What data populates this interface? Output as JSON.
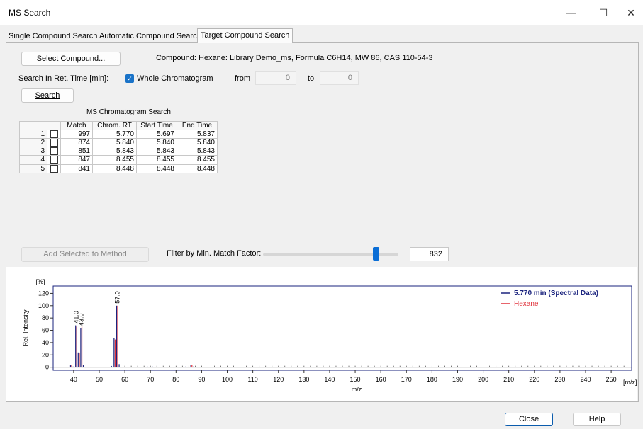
{
  "window": {
    "title": "MS Search",
    "minimize": "—",
    "maximize": "☐",
    "close": "✕"
  },
  "tabs": [
    {
      "label": "Single Compound Search",
      "active": false
    },
    {
      "label": "Automatic Compound Search",
      "active": false
    },
    {
      "label": "Target Compound Search",
      "active": true
    }
  ],
  "target": {
    "select_button": "Select Compound...",
    "compound_label": "Compound:",
    "compound_value": "Hexane: Library Demo_ms, Formula C6H14, MW 86, CAS 110-54-3",
    "search_in_label": "Search In Ret. Time [min]:",
    "whole_chrom_label": "Whole Chromatogram",
    "whole_chrom_checked": true,
    "from_label": "from",
    "from_value": "0",
    "to_label": "to",
    "to_value": "0",
    "search_button": "Search",
    "table_title": "MS Chromatogram Search",
    "columns": [
      "",
      "",
      "Match",
      "Chrom. RT",
      "Start Time",
      "End Time"
    ],
    "rows": [
      {
        "n": "1",
        "match": "997",
        "rt": "5.770",
        "start": "5.697",
        "end": "5.837"
      },
      {
        "n": "2",
        "match": "874",
        "rt": "5.840",
        "start": "5.840",
        "end": "5.840"
      },
      {
        "n": "3",
        "match": "851",
        "rt": "5.843",
        "start": "5.843",
        "end": "5.843"
      },
      {
        "n": "4",
        "match": "847",
        "rt": "8.455",
        "start": "8.455",
        "end": "8.455"
      },
      {
        "n": "5",
        "match": "841",
        "rt": "8.448",
        "start": "8.448",
        "end": "8.448"
      }
    ],
    "add_button": "Add Selected to Method",
    "filter_label": "Filter by Min. Match Factor:",
    "filter_value": "832",
    "filter_fraction": 0.83
  },
  "colors": {
    "spectral": "#1a237e",
    "library": "#e0303a",
    "accent": "#0b6ed6"
  },
  "chart_data": {
    "type": "bar",
    "xlabel": "m/z",
    "ylabel": "Rel. Intensity",
    "y_unit": "[%]",
    "x_unit": "[m/z]",
    "xlim": [
      32,
      258
    ],
    "ylim": [
      -5,
      132
    ],
    "x_ticks": [
      40,
      50,
      60,
      70,
      80,
      90,
      100,
      110,
      120,
      130,
      140,
      150,
      160,
      170,
      180,
      190,
      200,
      210,
      220,
      230,
      240,
      250
    ],
    "y_ticks": [
      0,
      20,
      40,
      60,
      80,
      100,
      120
    ],
    "legend": "top-right",
    "series": [
      {
        "name": "5.770 min (Spectral Data)",
        "color": "#1a237e",
        "x": [
          39,
          40,
          41,
          42,
          43,
          44,
          55,
          56,
          57,
          58,
          69,
          71,
          84,
          86,
          87
        ],
        "y": [
          3,
          1,
          68,
          24,
          64,
          3,
          2,
          47,
          100,
          5,
          1,
          1,
          1,
          4,
          1
        ]
      },
      {
        "name": "Hexane",
        "color": "#e0303a",
        "x": [
          39,
          41,
          42,
          43,
          56,
          57,
          86
        ],
        "y": [
          3,
          66,
          23,
          66,
          45,
          100,
          4
        ]
      }
    ],
    "peak_labels": [
      {
        "x": 41,
        "text": "41.0"
      },
      {
        "x": 43,
        "text": "43.0"
      },
      {
        "x": 57,
        "text": "57.0"
      }
    ]
  },
  "footer": {
    "close_button": "Close",
    "help_button": "Help"
  }
}
